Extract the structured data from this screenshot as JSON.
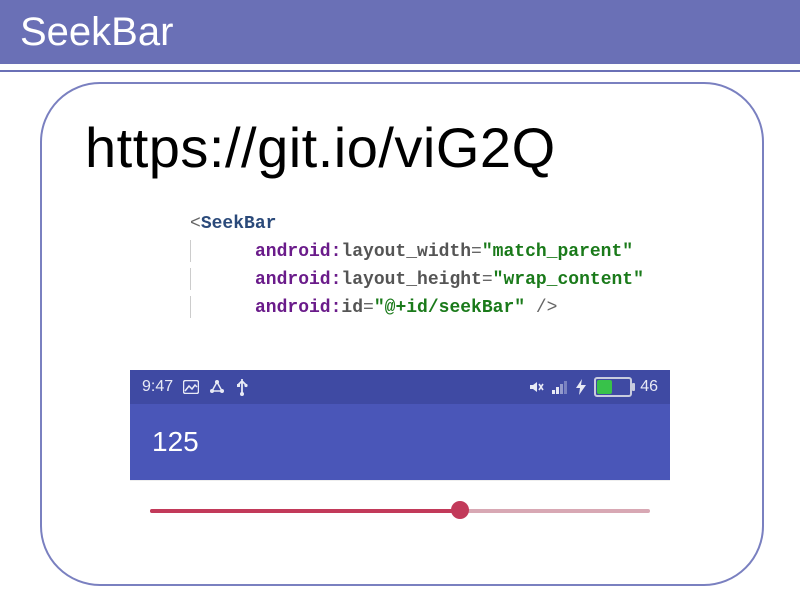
{
  "title": "SeekBar",
  "url": "https://git.io/viG2Q",
  "code": {
    "tag_open": "<",
    "tag_name": "SeekBar",
    "ns": "android:",
    "attr_width_name": "layout_width",
    "attr_width_val": "\"match_parent\"",
    "attr_height_name": "layout_height",
    "attr_height_val": "\"wrap_content\"",
    "attr_id_name": "id",
    "attr_id_val": "\"@+id/seekBar\"",
    "tag_close": " />"
  },
  "phone": {
    "time": "9:47",
    "battery_text": "46",
    "battery_pct": 46,
    "value": "125",
    "seek_pct": 62
  }
}
